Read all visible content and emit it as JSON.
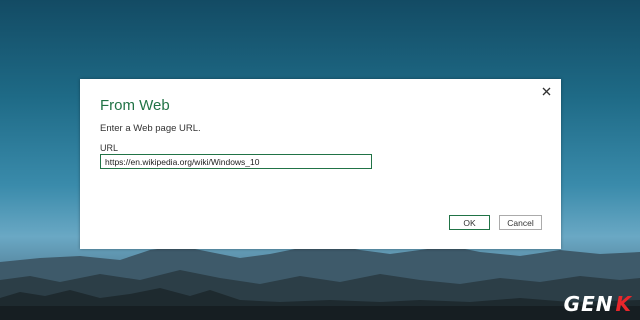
{
  "dialog": {
    "title": "From Web",
    "subtitle": "Enter a Web page URL.",
    "url_label": "URL",
    "url_value": "https://en.wikipedia.org/wiki/Windows_10",
    "ok_label": "OK",
    "cancel_label": "Cancel",
    "close_icon": "close-icon"
  },
  "watermark": {
    "text_prefix": "GEN",
    "text_suffix": "K"
  },
  "colors": {
    "accent": "#217346",
    "watermark_prefix": "#ffffff",
    "watermark_suffix": "#e8262b"
  }
}
